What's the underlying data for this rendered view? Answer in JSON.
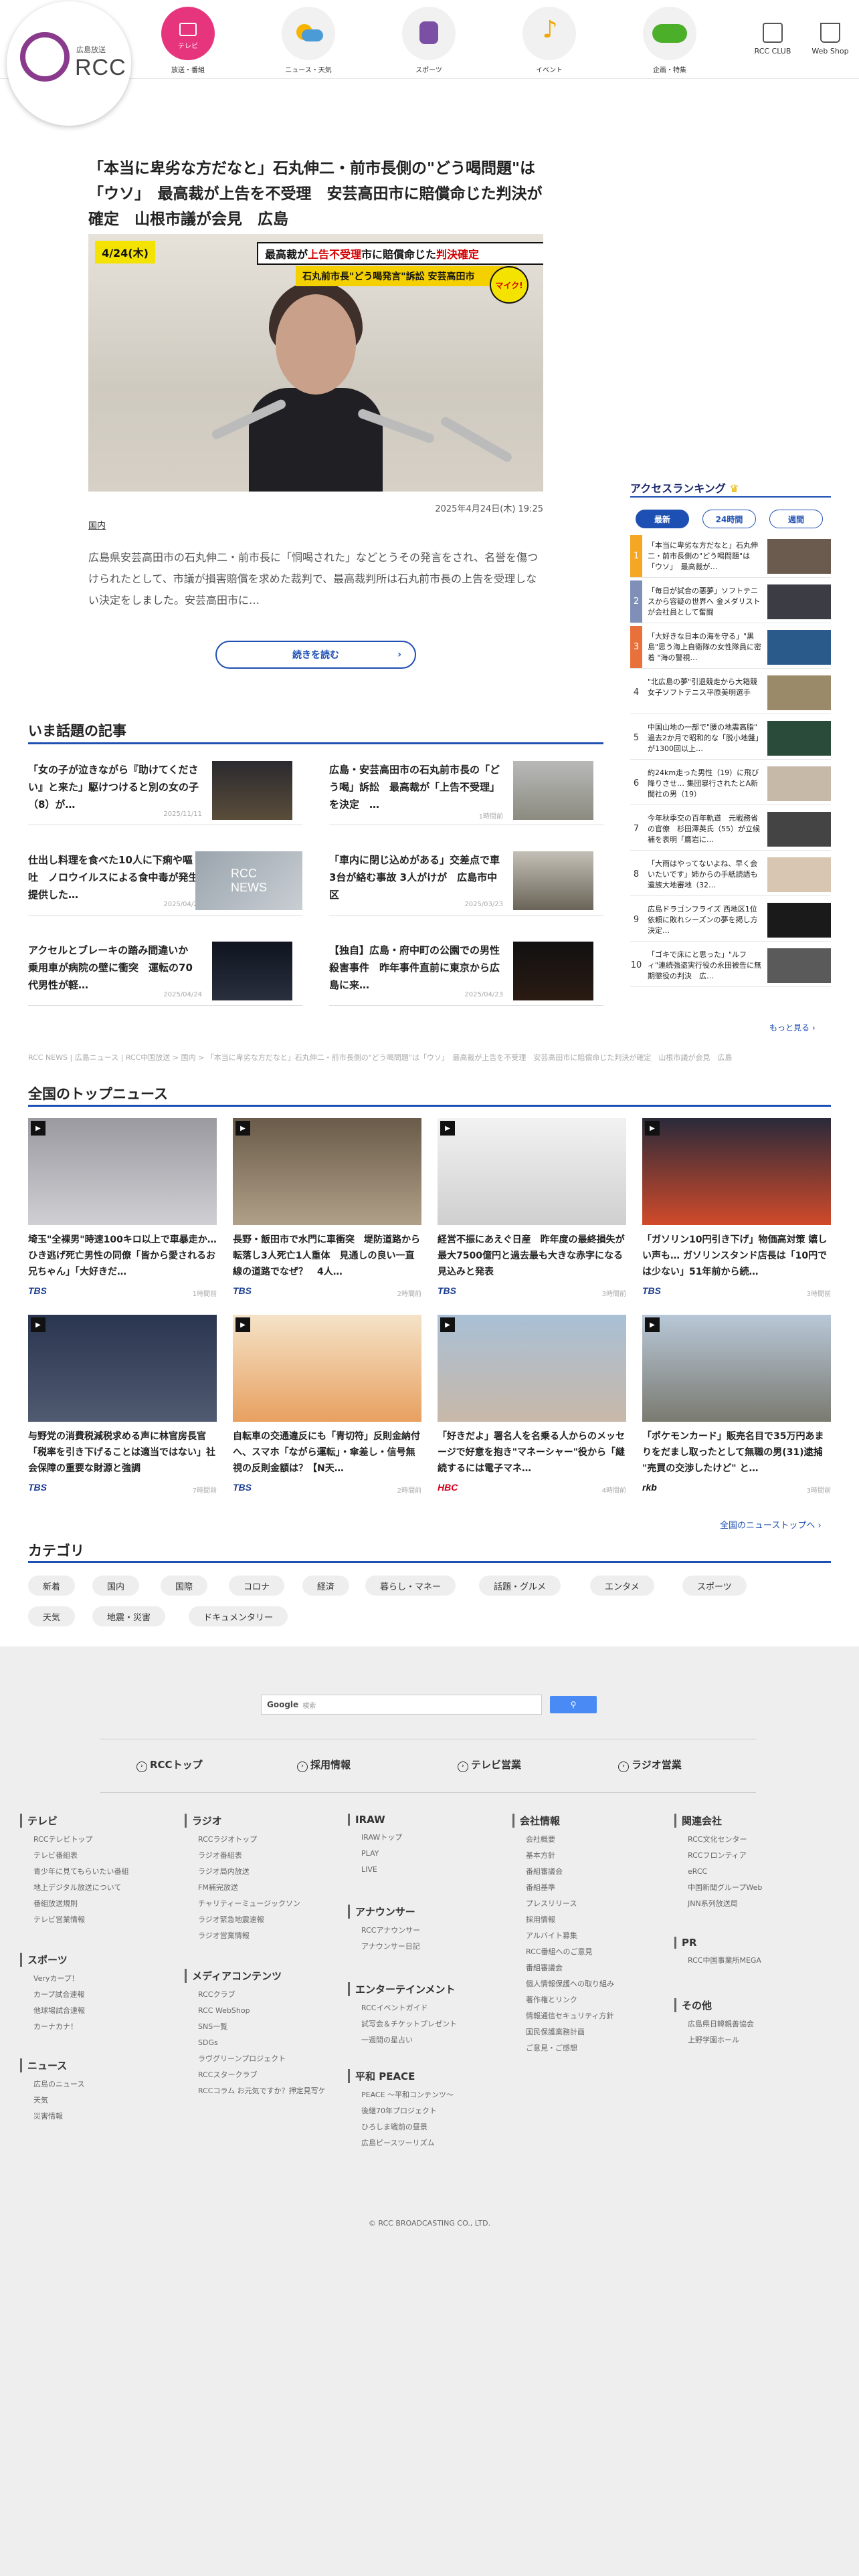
{
  "header": {
    "logo_sub": "広島放送",
    "logo_name": "RCC",
    "nav": [
      {
        "label": "放送・番組",
        "icon": "tv-icon"
      },
      {
        "label": "ニュース・天気",
        "icon": "weather-icon"
      },
      {
        "label": "スポーツ",
        "icon": "sports-icon"
      },
      {
        "label": "イベント",
        "icon": "music-note-icon"
      },
      {
        "label": "企画・特集",
        "icon": "love-green-icon"
      }
    ],
    "club": "RCC CLUB",
    "shop": "Web Shop"
  },
  "article": {
    "title": "「本当に卑劣な方だなと」石丸伸二・前市長側の\"どう喝問題\"は「ウソ」　最高裁が上告を不受理　安芸高田市に賠償命じた判決が確定　山根市議が会見　広島",
    "photo_date": "4/24(木)",
    "photo_cap1_a": "最高裁が",
    "photo_cap1_b": "上告不受理",
    "photo_cap1_c": " 市に賠償命じた",
    "photo_cap1_d": "判決確定",
    "photo_cap2": "石丸前市長\"どう喝発言\"訴訟 安芸高田市",
    "photo_badge": "マイク!",
    "date": "2025年4月24日(木) 19:25",
    "category": "国内",
    "desc": "広島県安芸高田市の石丸伸二・前市長に「恫喝された」などとうその発言をされ、名誉を傷つけられたとして、市議が損害賠償を求めた裁判で、最高裁判所は石丸前市長の上告を受理しない決定をしました。安芸高田市に…",
    "readmore": "続きを読む"
  },
  "popular": {
    "title": "いま話題の記事",
    "items": [
      {
        "title": "「女の子が泣きながら『助けてください』と来た」駆けつけると別の女の子（8）が…",
        "date": "2025/11/11"
      },
      {
        "title": "広島・安芸高田市の石丸前市長の「どう喝」訴訟　最高裁が「上告不受理」を決定　…",
        "date": "1時間前"
      },
      {
        "title": "仕出し料理を食べた10人に下痢や嘔吐　ノロウイルスによる食中毒が発生　提供した…",
        "date": "2025/04/22"
      },
      {
        "title": "「車内に閉じ込めがある」交差点で車3台が絡む事故 3人がけが　広島市中区",
        "date": "2025/03/23"
      },
      {
        "title": "アクセルとブレーキの踏み間違いか　乗用車が病院の壁に衝突　運転の70代男性が軽…",
        "date": "2025/04/24"
      },
      {
        "title": "【独自】広島・府中町の公園での男性殺害事件　昨年事件直前に東京から広島に来…",
        "date": "2025/04/23"
      }
    ]
  },
  "breadcrumb": "RCC NEWS | 広島ニュース | RCC中国放送 > 国内 > 「本当に卑劣な方だなと」石丸伸二・前市長側の\"どう喝問題\"は「ウソ」　最高裁が上告を不受理　安芸高田市に賠償命じた判決が確定　山根市議が会見　広島",
  "ranking": {
    "title": "アクセスランキング",
    "tabs": [
      "最新",
      "24時間",
      "週間"
    ],
    "items": [
      {
        "n": "1",
        "title": "「本当に卑劣な方だなと」石丸伸二・前市長側の\"どう喝問題\"は「ウソ」　最高裁が…",
        "color": "#f5a623"
      },
      {
        "n": "2",
        "title": "「毎日が試合の悪夢」ソフトテニスから容疑の世界へ 金メダリストが会社員として奮闘",
        "color": "#7f8fb8"
      },
      {
        "n": "3",
        "title": "「大好きな日本の海を守る」\"黒島\"思う海上自衛隊の女性隊員に密着 \"海の警視…",
        "color": "#e8703a"
      },
      {
        "n": "4",
        "title": "\"北広島の夢\"引退競走から大箱競　女子ソフトテニス平原美明選手",
        "color": ""
      },
      {
        "n": "5",
        "title": "中国山地の一部で\"腰の地震高脂\"　過去2か月で昭和的な「脱小地盤」が1300回以上…",
        "color": ""
      },
      {
        "n": "6",
        "title": "約24km走った男性（19）に飛び降りさせ… 集団暴行されたとA新聞社の男（19）",
        "color": ""
      },
      {
        "n": "7",
        "title": "今年秋季交の百年軌道　元戦務省の官僚　杉田澤英氏（55）が立候補を表明「鷹岩に…",
        "color": ""
      },
      {
        "n": "8",
        "title": "「大雨はやってないよね、早く会いたいです」姉からの手紙読語も　遺族大地審地（32…",
        "color": ""
      },
      {
        "n": "9",
        "title": "広島ドラゴンフライズ 西地区1位依頼に敗れシーズンの夢を掲し方決定…",
        "color": ""
      },
      {
        "n": "10",
        "title": "「ゴキで床にと思った」\"ルフィ\"連続強盗実行役の永田被告に無期懲役の判決　広…",
        "color": ""
      }
    ],
    "more": "もっと見る ›"
  },
  "national": {
    "title": "全国のトップニュース",
    "items": [
      {
        "title": "埼玉\"全裸男\"時速100キロ以上で車暴走か…ひき逃げ死亡男性の同僚「皆から愛されるお兄ちゃん」「大好きだ…",
        "src": "TBS",
        "time": "1時間前",
        "srccolor": "#1a3c8f"
      },
      {
        "title": "長野・飯田市で水門に車衝突　堤防道路から転落し3人死亡1人重体　見通しの良い一直線の道路でなぜ？　4人…",
        "src": "TBS",
        "time": "2時間前",
        "srccolor": "#1a3c8f"
      },
      {
        "title": "経営不振にあえぐ日産　昨年度の最終損失が最大7500億円と過去最も大きな赤字になる見込みと発表",
        "src": "TBS",
        "time": "3時間前",
        "srccolor": "#1a3c8f"
      },
      {
        "title": "「ガソリン10円引き下げ」物価高対策 嬉しい声も… ガソリンスタンド店長は「10円では少ない」51年前から続…",
        "src": "TBS",
        "time": "3時間前",
        "srccolor": "#1a3c8f"
      },
      {
        "title": "与野党の消費税減税求める声に林官房長官「税率を引き下げることは適当ではない」社会保障の重要な財源と強調",
        "src": "TBS",
        "time": "7時間前",
        "srccolor": "#1a3c8f"
      },
      {
        "title": "自転車の交通違反にも「青切符」反則金納付へ、スマホ「ながら運転」・傘差し・信号無視の反則金額は？【N天…",
        "src": "TBS",
        "time": "2時間前",
        "srccolor": "#1a3c8f"
      },
      {
        "title": "「好きだよ」署名人を名乗る人からのメッセージで好意を抱き\"マネーシャー\"役から「継続するには電子マネ…",
        "src": "HBC",
        "time": "4時間前",
        "srccolor": "#d4001a"
      },
      {
        "title": "「ポケモンカード」販売名目で35万円あまりをだまし取ったとして無職の男(31)逮捕 \"売買の交渉したけど\" と…",
        "src": "rkb",
        "time": "3時間前",
        "srccolor": "#111"
      }
    ],
    "more": "全国のニューストップへ ›"
  },
  "categories": {
    "title": "カテゴリ",
    "items": [
      "新着",
      "国内",
      "国際",
      "コロナ",
      "経済",
      "暮らし・マネー",
      "話題・グルメ",
      "エンタメ",
      "スポーツ",
      "天気",
      "地震・災害",
      "ドキュメンタリー"
    ]
  },
  "footer": {
    "search_brand": "Google",
    "search_placeholder": "検索",
    "nav": [
      "RCCトップ",
      "採用情報",
      "テレビ営業",
      "ラジオ営業"
    ],
    "cols": [
      {
        "h": "テレビ",
        "l": [
          "RCCテレビトップ",
          "テレビ番組表",
          "青少年に見てもらいたい番組",
          "地上デジタル放送について",
          "番組放送規則",
          "テレビ営業情報"
        ]
      },
      {
        "h": "ラジオ",
        "l": [
          "RCCラジオトップ",
          "ラジオ番組表",
          "ラジオ局内放送",
          "FM補完放送",
          "チャリティーミュージックソン",
          "ラジオ緊急地震速報",
          "ラジオ営業情報"
        ]
      },
      {
        "h": "IRAW",
        "l": [
          "IRAWトップ",
          "PLAY",
          "LIVE"
        ]
      },
      {
        "h": "会社情報",
        "l": [
          "会社概要",
          "基本方針",
          "番組審議会",
          "番組基準",
          "プレスリリース",
          "採用情報",
          "アルバイト募集",
          "RCC番組へのご意見",
          "番組審議会",
          "個人情報保護への取り組み",
          "著作権とリンク",
          "情報通信セキュリティ方針",
          "国民保護業務計画",
          "ご意見・ご感想"
        ]
      },
      {
        "h": "関連会社",
        "l": [
          "RCC文化センター",
          "RCCフロンティア",
          "eRCC",
          "中国新聞グループWeb",
          "JNN系列放送局"
        ]
      },
      {
        "h": "スポーツ",
        "l": [
          "Veryカープ！",
          "カープ試合速報",
          "他球場試合速報",
          "カーナカナ！"
        ]
      },
      {
        "h": "メディアコンテンツ",
        "l": [
          "RCCクラブ",
          "RCC WebShop",
          "SNS一覧",
          "SDGs",
          "ラヴグリーンプロジェクト",
          "RCCスタークラブ",
          "RCCコラム お元気ですか？押定見写ケ"
        ]
      },
      {
        "h": "アナウンサー",
        "l": [
          "RCCアナウンサー",
          "アナウンサー日記"
        ]
      },
      {
        "h": "PR",
        "l": [
          "RCC中国事業所MEGA"
        ]
      },
      {
        "h": "エンターテインメント",
        "l": [
          "RCCイベントガイド",
          "試写会＆チケットプレゼント",
          "一週間の星占い"
        ]
      },
      {
        "h": "その他",
        "l": [
          "広島県日韓親善協会",
          "上野学園ホール"
        ]
      },
      {
        "h": "ニュース",
        "l": [
          "広島のニュース",
          "天気",
          "災害情報"
        ]
      },
      {
        "h": "平和 PEACE",
        "l": [
          "PEACE ～平和コンテンツ～",
          "後継70年プロジェクト",
          "ひろしま戦前の昼景",
          "広島ピースツーリズム"
        ]
      }
    ],
    "copyright": "© RCC BROADCASTING CO., LTD."
  }
}
